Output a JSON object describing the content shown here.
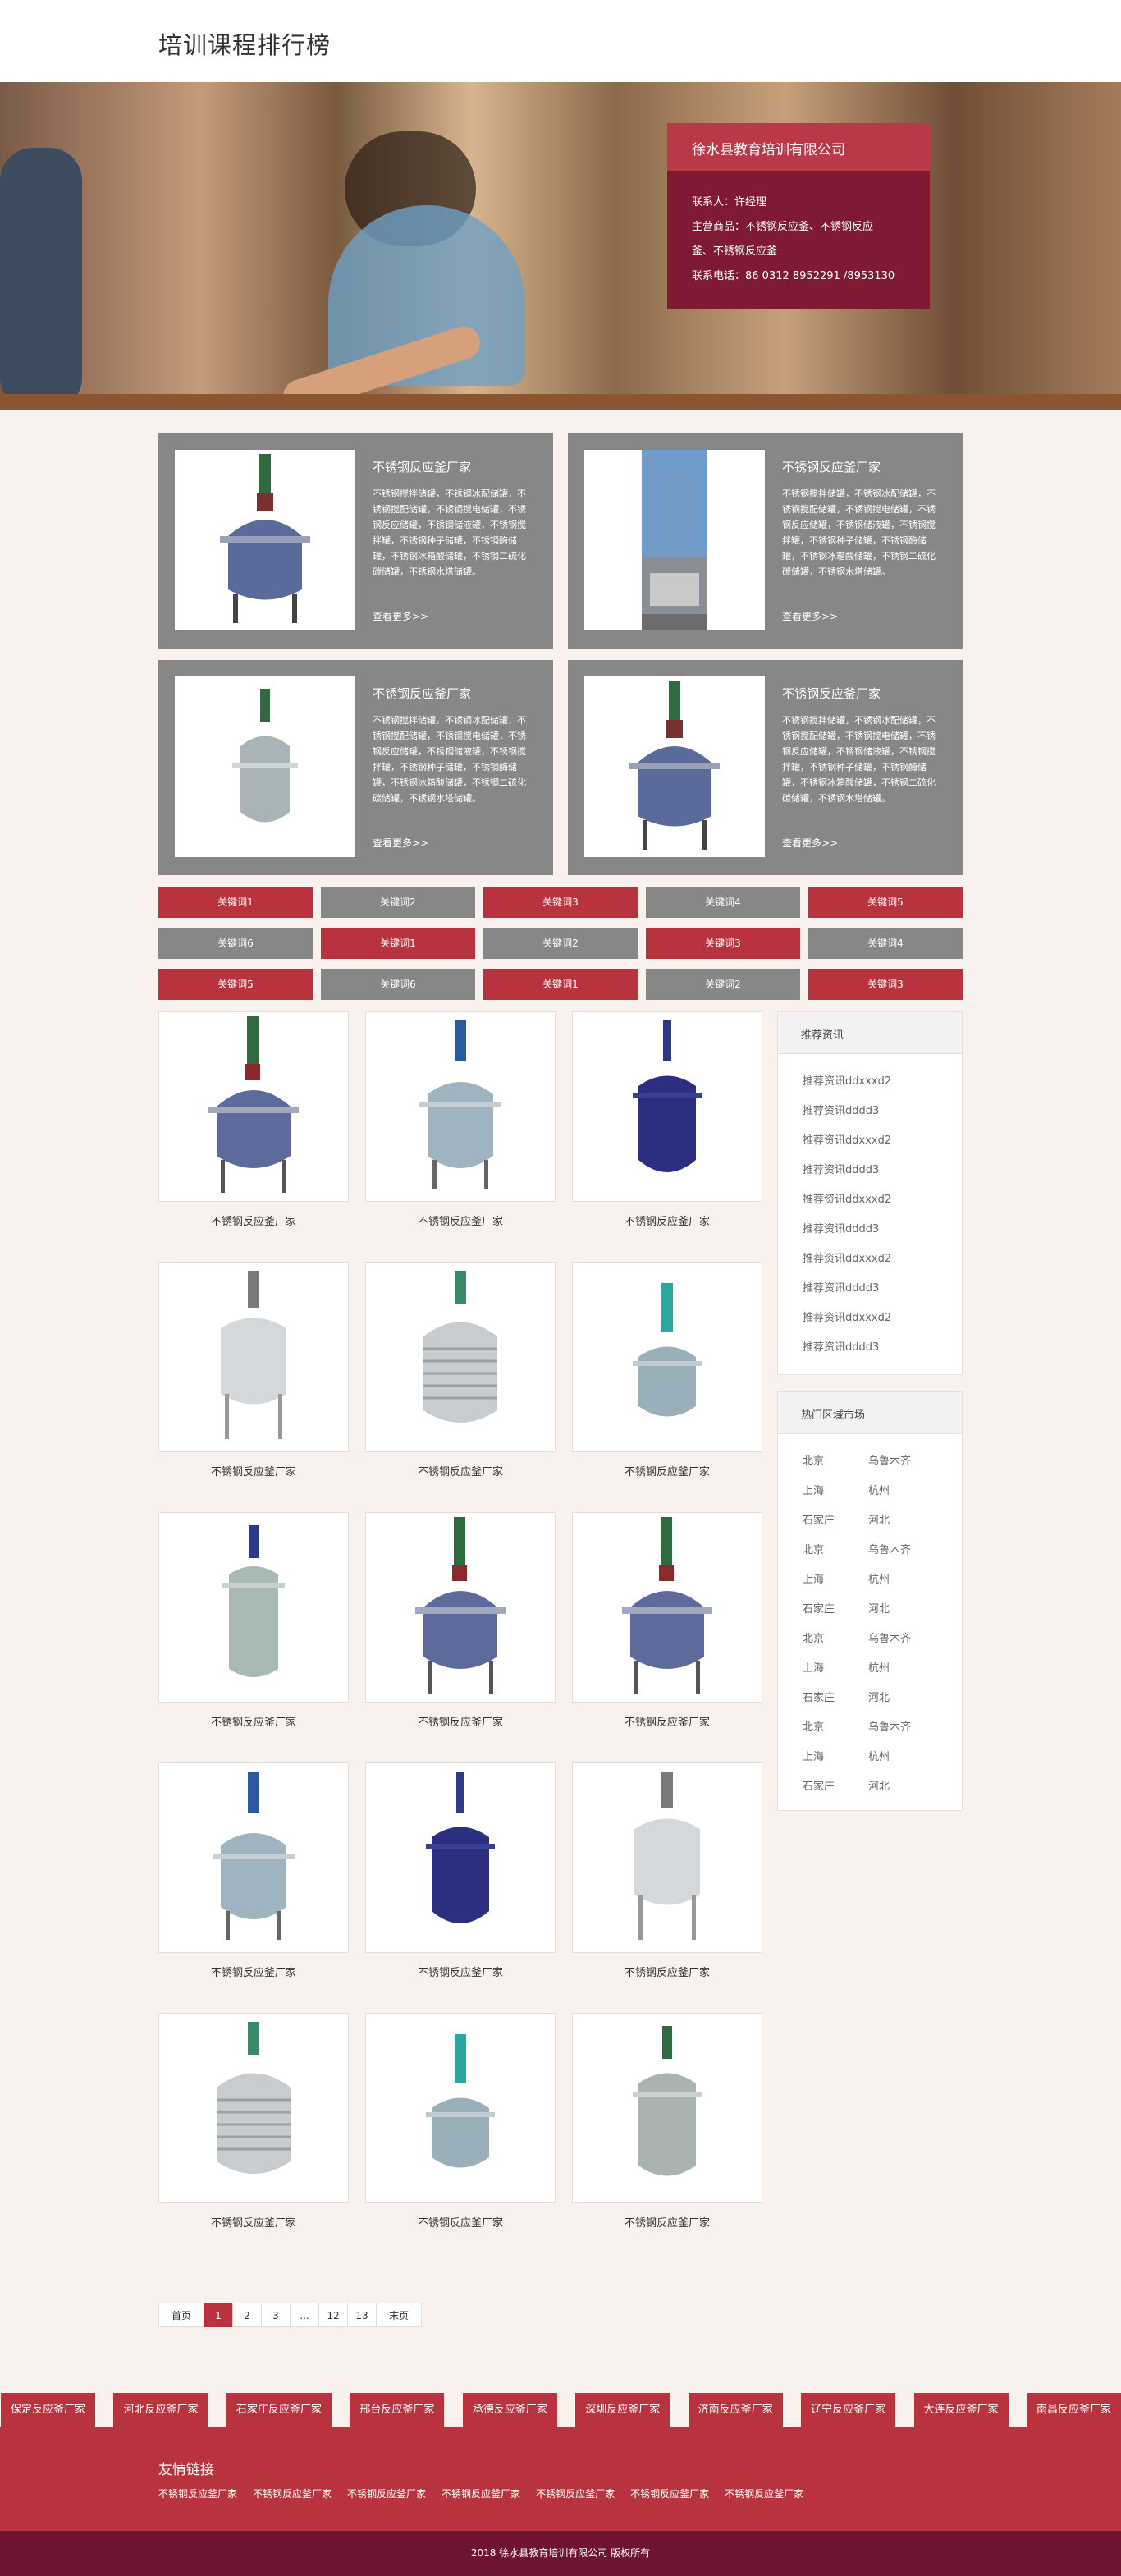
{
  "header": {
    "title": "培训课程排行榜"
  },
  "company": {
    "name": "徐水县教育培训有限公司",
    "contact": "联系人：许经理",
    "products": "主营商品：不锈钢反应釜、不锈钢反应",
    "products2": "釜、不锈钢反应釜",
    "phone": "联系电话：86 0312 8952291 /8953130"
  },
  "featured": [
    {
      "title": "不锈钢反应釜厂家",
      "desc": "不锈钢搅拌储罐，不锈钢冰配储罐，不锈钢搅配储罐，不锈钢搅电储罐，不锈钢反应储罐，不锈钢储液罐，不锈钢搅拌罐，不锈钢种子储罐，不锈钢酶储罐，不锈钢冰箱酸储罐，不锈钢二硫化碳储罐，不锈钢水塔储罐。",
      "more": "查看更多>>"
    },
    {
      "title": "不锈钢反应釜厂家",
      "desc": "不锈钢搅拌储罐，不锈钢冰配储罐，不锈钢搅配储罐，不锈钢搅电储罐，不锈钢反应储罐，不锈钢储液罐，不锈钢搅拌罐，不锈钢种子储罐，不锈钢酶储罐，不锈钢冰箱酸储罐，不锈钢二硫化碳储罐，不锈钢水塔储罐。",
      "more": "查看更多>>"
    },
    {
      "title": "不锈钢反应釜厂家",
      "desc": "不锈钢搅拌储罐，不锈钢冰配储罐，不锈钢搅配储罐，不锈钢搅电储罐，不锈钢反应储罐，不锈钢储液罐，不锈钢搅拌罐，不锈钢种子储罐，不锈钢酶储罐，不锈钢冰箱酸储罐，不锈钢二硫化碳储罐，不锈钢水塔储罐。",
      "more": "查看更多>>"
    },
    {
      "title": "不锈钢反应釜厂家",
      "desc": "不锈钢搅拌储罐，不锈钢冰配储罐，不锈钢搅配储罐，不锈钢搅电储罐，不锈钢反应储罐，不锈钢储液罐，不锈钢搅拌罐，不锈钢种子储罐，不锈钢酶储罐，不锈钢冰箱酸储罐，不锈钢二硫化碳储罐，不锈钢水塔储罐。",
      "more": "查看更多>>"
    }
  ],
  "keywords": [
    "关键词1",
    "关键词2",
    "关键词3",
    "关键词4",
    "关键词5",
    "关键词6",
    "关键词1",
    "关键词2",
    "关键词3",
    "关键词4",
    "关键词5",
    "关键词6",
    "关键词1",
    "关键词2",
    "关键词3"
  ],
  "products": [
    "不锈钢反应釜厂家",
    "不锈钢反应釜厂家",
    "不锈钢反应釜厂家",
    "不锈钢反应釜厂家",
    "不锈钢反应釜厂家",
    "不锈钢反应釜厂家",
    "不锈钢反应釜厂家",
    "不锈钢反应釜厂家",
    "不锈钢反应釜厂家",
    "不锈钢反应釜厂家",
    "不锈钢反应釜厂家",
    "不锈钢反应釜厂家",
    "不锈钢反应釜厂家",
    "不锈钢反应釜厂家",
    "不锈钢反应釜厂家"
  ],
  "news": {
    "title": "推荐资讯",
    "items": [
      "推荐资讯ddxxxd2",
      "推荐资讯dddd3",
      "推荐资讯ddxxxd2",
      "推荐资讯dddd3",
      "推荐资讯ddxxxd2",
      "推荐资讯dddd3",
      "推荐资讯ddxxxd2",
      "推荐资讯dddd3",
      "推荐资讯ddxxxd2",
      "推荐资讯dddd3"
    ]
  },
  "hotcities": {
    "title": "热门区域市场",
    "items": [
      "北京",
      "乌鲁木齐",
      "上海",
      "杭州",
      "石家庄",
      "河北",
      "北京",
      "乌鲁木齐",
      "上海",
      "杭州",
      "石家庄",
      "河北",
      "北京",
      "乌鲁木齐",
      "上海",
      "杭州",
      "石家庄",
      "河北",
      "北京",
      "乌鲁木齐",
      "上海",
      "杭州",
      "石家庄",
      "河北"
    ]
  },
  "pager": {
    "first": "首页",
    "p1": "1",
    "p2": "2",
    "p3": "3",
    "dots": "...",
    "p12": "12",
    "p13": "13",
    "last": "末页"
  },
  "citylinks": [
    "保定反应釜厂家",
    "河北反应釜厂家",
    "石家庄反应釜厂家",
    "邢台反应釜厂家",
    "承德反应釜厂家",
    "深圳反应釜厂家",
    "济南反应釜厂家",
    "辽宁反应釜厂家",
    "大连反应釜厂家",
    "南昌反应釜厂家"
  ],
  "friend": {
    "title": "友情链接",
    "links": [
      "不锈钢反应釜厂家",
      "不锈钢反应釜厂家",
      "不锈钢反应釜厂家",
      "不锈钢反应釜厂家",
      "不锈钢反应釜厂家",
      "不锈钢反应釜厂家",
      "不锈钢反应釜厂家"
    ]
  },
  "footer": {
    "copyright": "2018 徐水县教育培训有限公司 版权所有"
  }
}
